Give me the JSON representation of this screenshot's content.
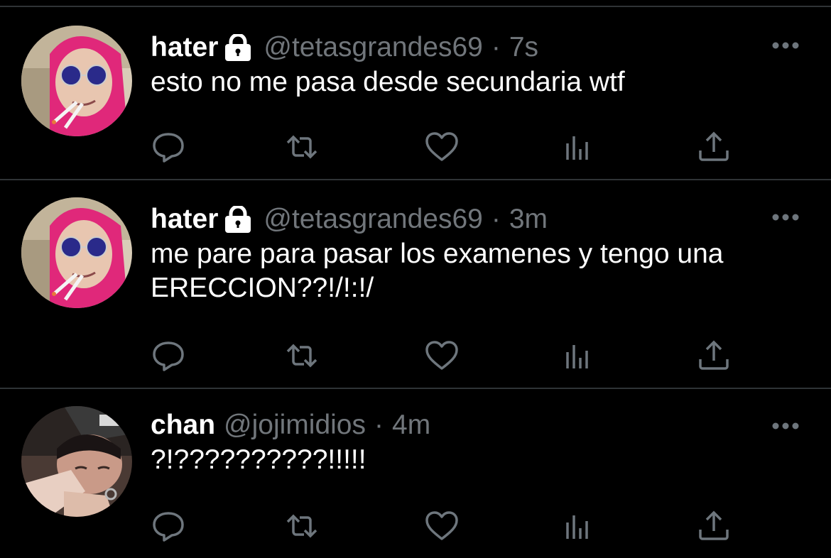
{
  "colors": {
    "background": "#000000",
    "separator": "#2f3336",
    "text_primary": "#ffffff",
    "text_secondary": "#71767b",
    "icon": "#6e767d"
  },
  "tweets": [
    {
      "display_name": "hater",
      "protected": true,
      "handle": "@tetasgrandes69",
      "separator": "·",
      "time": "7s",
      "text": "esto no me pasa desde secundaria wtf",
      "avatar": "pink-hood-sunglasses-avatar"
    },
    {
      "display_name": "hater",
      "protected": true,
      "handle": "@tetasgrandes69",
      "separator": "·",
      "time": "3m",
      "text": "me pare para pasar los examenes y tengo una\nERECCION??!/!:!/",
      "avatar": "pink-hood-sunglasses-avatar"
    },
    {
      "display_name": "chan",
      "protected": false,
      "handle": "@jojimidios",
      "separator": "·",
      "time": "4m",
      "text": "?!??????????!!!!!",
      "avatar": "dark-selfie-avatar"
    }
  ],
  "icons": {
    "reply": "reply-icon",
    "retweet": "retweet-icon",
    "like": "like-icon",
    "views": "views-icon",
    "share": "share-icon",
    "more": "more-icon",
    "lock": "lock-icon"
  }
}
